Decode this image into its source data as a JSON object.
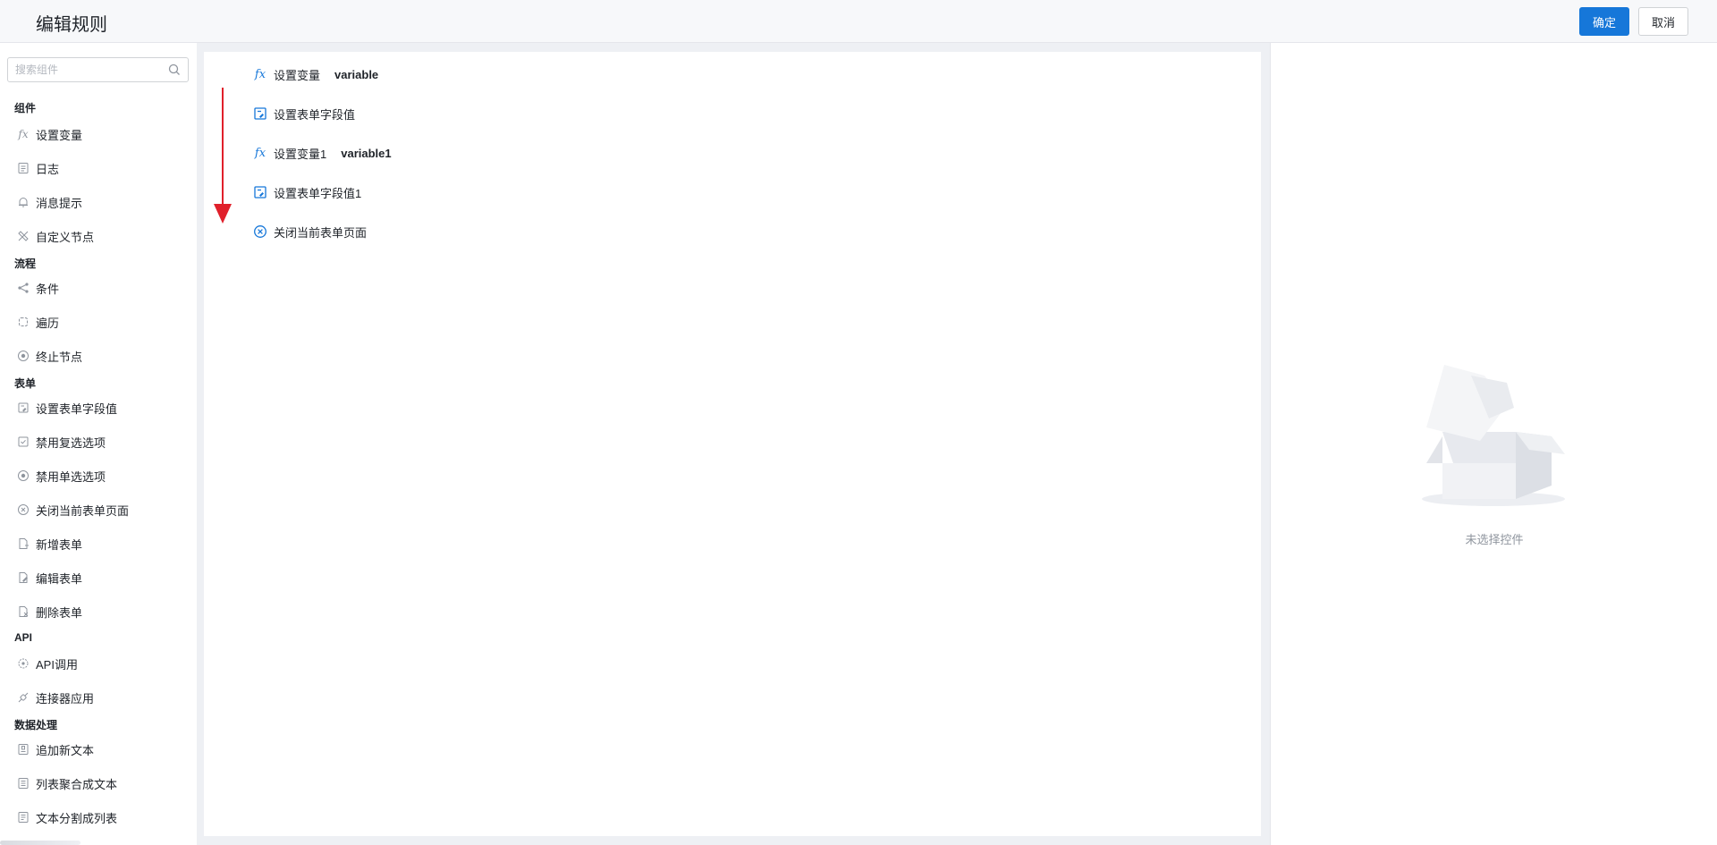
{
  "header": {
    "title": "编辑规则",
    "confirm_label": "确定",
    "cancel_label": "取消"
  },
  "sidebar": {
    "search_placeholder": "搜索组件",
    "groups": [
      {
        "title": "组件",
        "items": [
          {
            "label": "设置变量",
            "icon": "fx-icon"
          },
          {
            "label": "日志",
            "icon": "log-icon"
          },
          {
            "label": "消息提示",
            "icon": "bell-icon"
          },
          {
            "label": "自定义节点",
            "icon": "custom-node-icon"
          }
        ]
      },
      {
        "title": "流程",
        "items": [
          {
            "label": "条件",
            "icon": "branch-icon"
          },
          {
            "label": "遍历",
            "icon": "loop-icon"
          },
          {
            "label": "终止节点",
            "icon": "stop-icon"
          }
        ]
      },
      {
        "title": "表单",
        "items": [
          {
            "label": "设置表单字段值",
            "icon": "form-field-icon"
          },
          {
            "label": "禁用复选选项",
            "icon": "checkbox-icon"
          },
          {
            "label": "禁用单选选项",
            "icon": "radio-icon"
          },
          {
            "label": "关闭当前表单页面",
            "icon": "close-circle-icon"
          },
          {
            "label": "新增表单",
            "icon": "add-form-icon"
          },
          {
            "label": "编辑表单",
            "icon": "edit-form-icon"
          },
          {
            "label": "删除表单",
            "icon": "delete-form-icon"
          }
        ]
      },
      {
        "title": "API",
        "items": [
          {
            "label": "API调用",
            "icon": "api-icon"
          },
          {
            "label": "连接器应用",
            "icon": "connector-icon"
          }
        ]
      },
      {
        "title": "数据处理",
        "items": [
          {
            "label": "追加新文本",
            "icon": "append-text-icon"
          },
          {
            "label": "列表聚合成文本",
            "icon": "list-join-icon"
          },
          {
            "label": "文本分割成列表",
            "icon": "text-split-icon"
          }
        ]
      }
    ]
  },
  "canvas": {
    "nodes": [
      {
        "label": "设置变量",
        "variable": "variable",
        "icon": "fx-icon"
      },
      {
        "label": "设置表单字段值",
        "variable": "",
        "icon": "form-field-icon"
      },
      {
        "label": "设置变量1",
        "variable": "variable1",
        "icon": "fx-icon"
      },
      {
        "label": "设置表单字段值1",
        "variable": "",
        "icon": "form-field-icon"
      },
      {
        "label": "关闭当前表单页面",
        "variable": "",
        "icon": "close-circle-icon"
      }
    ],
    "arrow_color": "#e0202b"
  },
  "panel": {
    "empty_text": "未选择控件"
  },
  "colors": {
    "accent": "#1677d9",
    "text": "#1f2329",
    "muted": "#8f959e"
  }
}
